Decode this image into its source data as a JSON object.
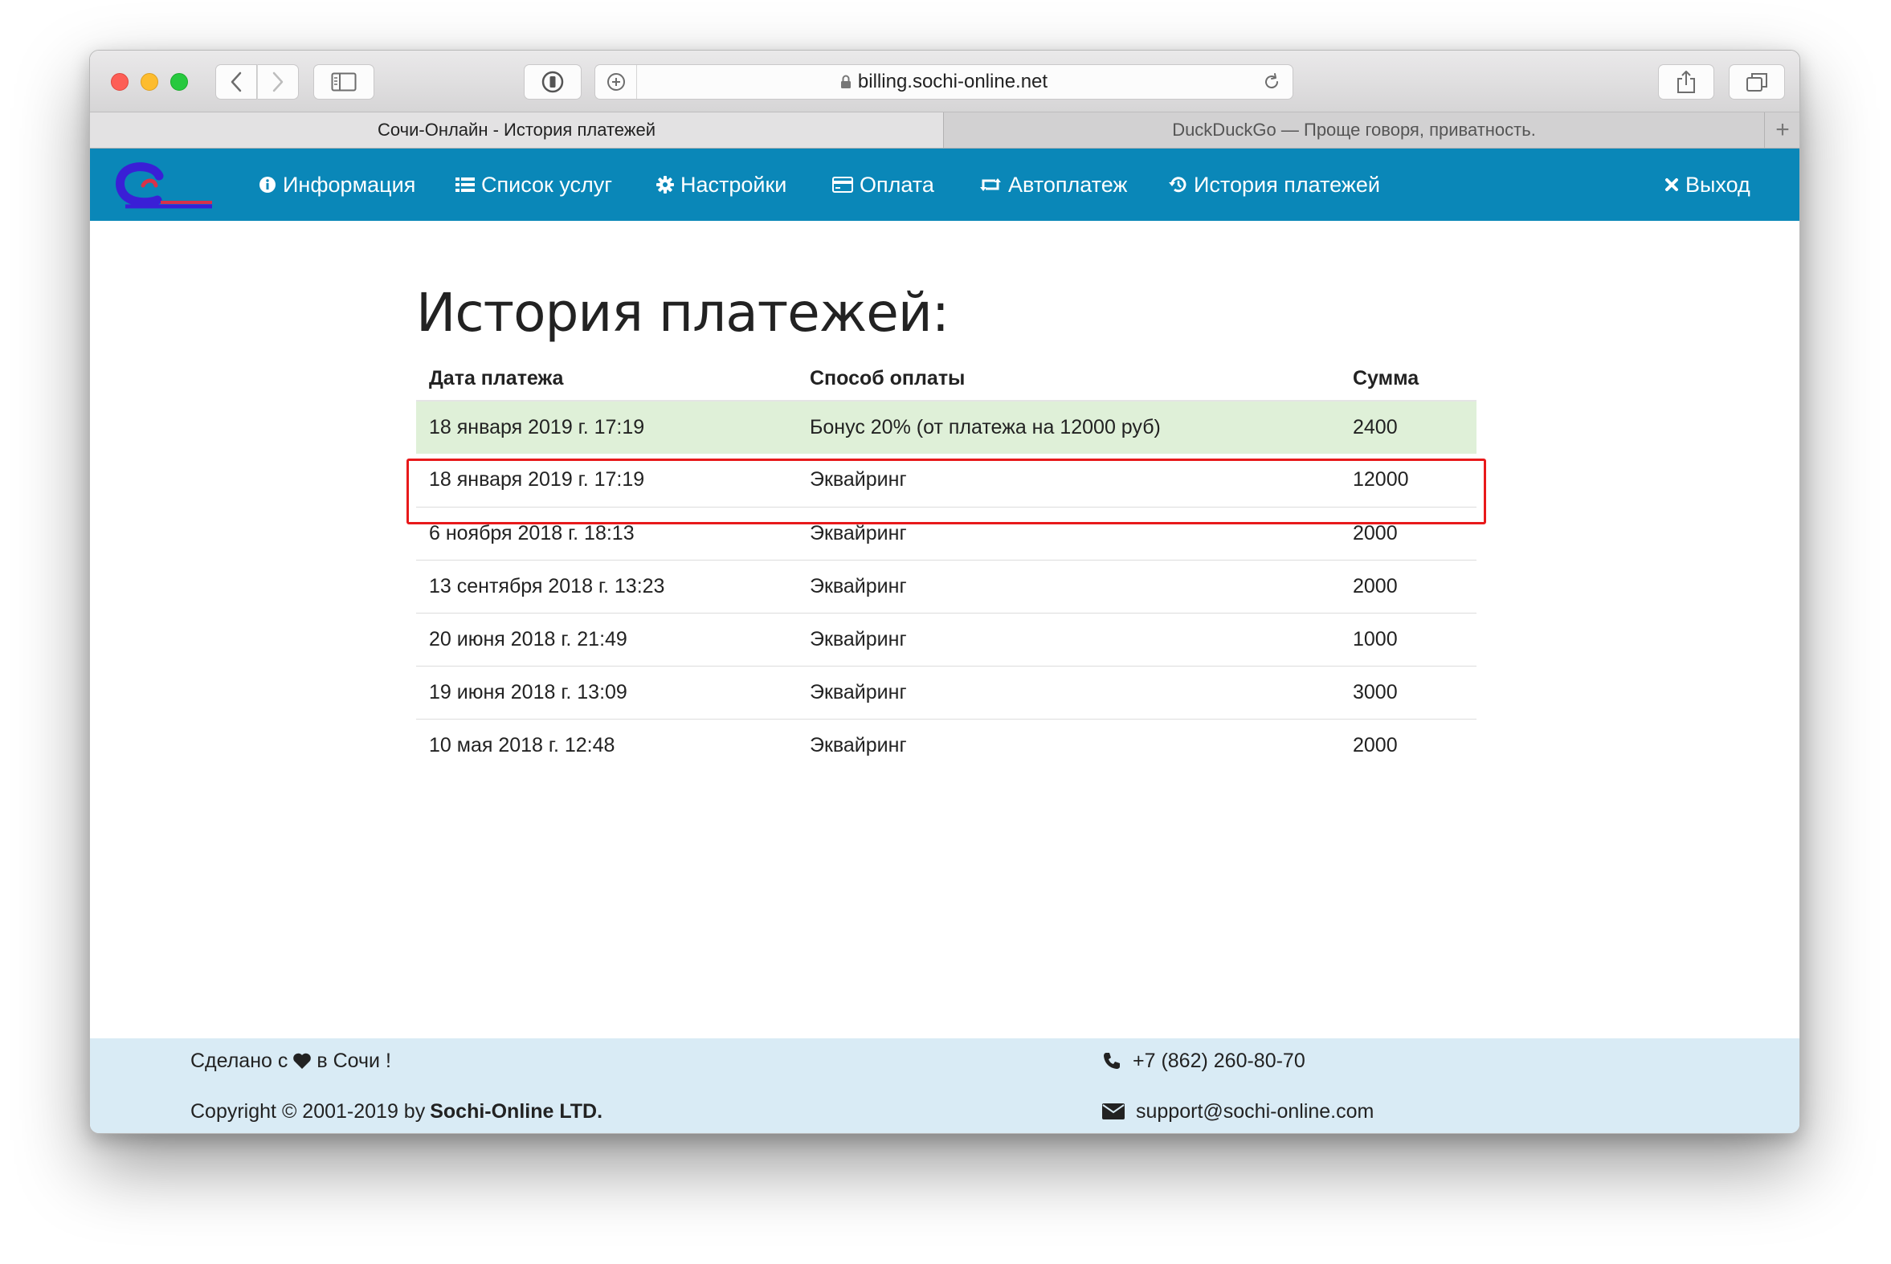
{
  "browser": {
    "url": "billing.sochi-online.net",
    "tabs": [
      {
        "label": "Сочи-Онлайн - История платежей",
        "active": true
      },
      {
        "label": "DuckDuckGo — Проще говоря, приватность.",
        "active": false
      }
    ],
    "new_tab_label": "+"
  },
  "nav": {
    "items": [
      {
        "label": "Информация",
        "icon": "info-circle-icon"
      },
      {
        "label": "Список услуг",
        "icon": "list-icon"
      },
      {
        "label": "Настройки",
        "icon": "gear-icon"
      },
      {
        "label": "Оплата",
        "icon": "credit-card-icon"
      },
      {
        "label": "Автоплатеж",
        "icon": "retweet-icon"
      },
      {
        "label": "История платежей",
        "icon": "history-icon"
      }
    ],
    "logout": {
      "label": "Выход",
      "icon": "close-icon"
    },
    "brand_color": "#0a87b8"
  },
  "main": {
    "title": "История платежей:",
    "columns": [
      "Дата платежа",
      "Способ оплаты",
      "Сумма"
    ],
    "rows": [
      {
        "date": "18 января 2019 г. 17:19",
        "method": "Бонус 20% (от платежа на 12000 руб)",
        "amount": "2400",
        "highlighted": true
      },
      {
        "date": "18 января 2019 г. 17:19",
        "method": "Эквайринг",
        "amount": "12000"
      },
      {
        "date": "6 ноября 2018 г. 18:13",
        "method": "Эквайринг",
        "amount": "2000"
      },
      {
        "date": "13 сентября 2018 г. 13:23",
        "method": "Эквайринг",
        "amount": "2000"
      },
      {
        "date": "20 июня 2018 г. 21:49",
        "method": "Эквайринг",
        "amount": "1000"
      },
      {
        "date": "19 июня 2018 г. 13:09",
        "method": "Эквайринг",
        "amount": "3000"
      },
      {
        "date": "10 мая 2018 г. 12:48",
        "method": "Эквайринг",
        "amount": "2000"
      }
    ],
    "highlight_row_color": "#dff0d8",
    "annotation_color": "#e8191b"
  },
  "footer": {
    "made_prefix": "Сделано с",
    "made_suffix": "в Сочи !",
    "copyright_prefix": "Copyright © 2001-2019 by",
    "company": "Sochi-Online LTD.",
    "phone": "+7 (862) 260-80-70",
    "email": "support@sochi-online.com",
    "background": "#d9ebf5"
  }
}
